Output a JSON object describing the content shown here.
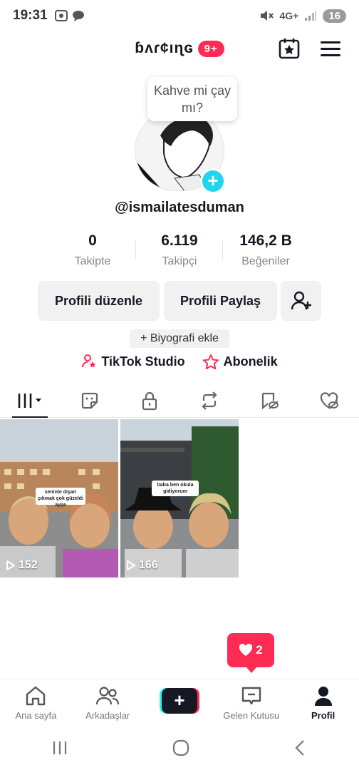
{
  "status_bar": {
    "time": "19:31",
    "network": "4G+",
    "battery": "16"
  },
  "header": {
    "username_stylized": "ɓʌɾ¢ıɳɢ",
    "notification_badge": "9+"
  },
  "profile": {
    "note_bubble": "Kahve mi çay mı?",
    "handle": "@ismailatesduman",
    "stats": [
      {
        "value": "0",
        "label": "Takipte"
      },
      {
        "value": "6.119",
        "label": "Takipçi"
      },
      {
        "value": "146,2 B",
        "label": "Beğeniler"
      }
    ],
    "buttons": {
      "edit": "Profili düzenle",
      "share": "Profili Paylaş"
    },
    "add_bio": "+ Biyografi ekle",
    "links": {
      "studio": "TikTok Studio",
      "subscription": "Abonelik"
    }
  },
  "videos": [
    {
      "views": "152",
      "caption": "seninle dışarı çıkmak çok güzeldi ayşe"
    },
    {
      "views": "166",
      "caption": "baba ben okula gidiyorum"
    }
  ],
  "like_popup": {
    "count": "2"
  },
  "bottom_nav": [
    {
      "label": "Ana sayfa"
    },
    {
      "label": "Arkadaşlar"
    },
    {
      "label": ""
    },
    {
      "label": "Gelen Kutusu"
    },
    {
      "label": "Profil"
    }
  ],
  "colors": {
    "accent": "#fe2c55",
    "cyan": "#20d5ec",
    "text": "#161823"
  }
}
